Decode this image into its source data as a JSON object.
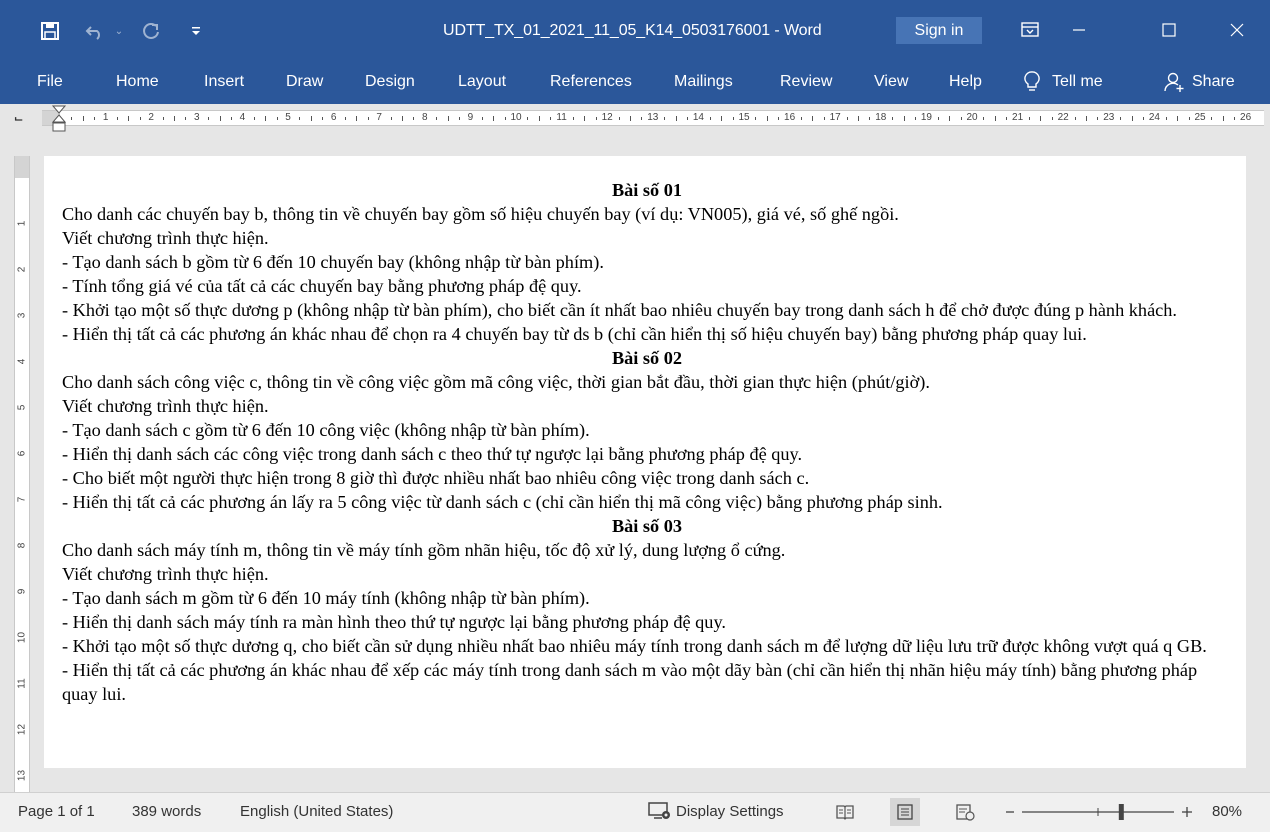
{
  "titlebar": {
    "doc_title": "UDTT_TX_01_2021_11_05_K14_0503176001  -  Word",
    "signin_label": "Sign in",
    "accent_color": "#2b579a"
  },
  "ribbon": {
    "tabs": [
      "File",
      "Home",
      "Insert",
      "Draw",
      "Design",
      "Layout",
      "References",
      "Mailings",
      "Review",
      "View",
      "Help"
    ],
    "tell_me": "Tell me",
    "share": "Share"
  },
  "ruler": {
    "labels": [
      "1",
      "2",
      "3",
      "4",
      "5",
      "6",
      "7",
      "8",
      "9",
      "10",
      "11",
      "12",
      "13",
      "14",
      "15",
      "16",
      "17",
      "18",
      "19",
      "20",
      "21",
      "22",
      "23",
      "24",
      "25",
      "26"
    ],
    "vertical_labels": [
      "1",
      "2",
      "3",
      "4",
      "5",
      "6",
      "7",
      "8",
      "9",
      "10",
      "11",
      "12",
      "13"
    ]
  },
  "document": {
    "sections": [
      {
        "heading": "Bài số 01",
        "lines": [
          "Cho danh các chuyến bay b, thông tin về chuyến bay gồm số hiệu chuyến bay (ví dụ: VN005), giá vé, số ghế ngồi.",
          "Viết chương trình thực hiện.",
          "- Tạo danh sách b gồm từ 6 đến 10 chuyến bay (không nhập từ bàn phím).",
          "- Tính tổng giá vé của tất cả các chuyến bay bằng phương pháp đệ quy.",
          "- Khởi tạo một số thực dương p (không nhập từ bàn phím), cho biết cần ít nhất bao nhiêu chuyến bay trong danh sách h để chở được đúng p hành khách.",
          "- Hiển thị tất cả các phương án khác nhau để chọn ra 4 chuyến bay từ ds b (chỉ cần hiển thị số hiệu chuyến bay) bằng phương pháp quay lui."
        ]
      },
      {
        "heading": "Bài số 02",
        "lines": [
          "Cho danh sách công việc c, thông tin về công việc gồm mã công việc, thời gian bắt đầu, thời gian thực hiện (phút/giờ).",
          "Viết chương trình thực hiện.",
          "- Tạo danh sách c gồm từ 6 đến 10 công việc (không nhập từ bàn phím).",
          "- Hiển thị danh sách các công việc trong danh sách c theo thứ tự ngược lại bằng phương pháp đệ quy.",
          "- Cho biết một người thực hiện trong 8 giờ thì được nhiều nhất bao nhiêu công việc trong danh sách c.",
          "- Hiển thị tất cả các phương án lấy ra 5 công việc từ danh sách c (chỉ cần hiển thị mã công việc) bằng phương pháp sinh."
        ]
      },
      {
        "heading": "Bài số 03",
        "lines": [
          "Cho danh sách máy tính m, thông tin về máy tính gồm nhãn hiệu, tốc độ xử lý, dung lượng ổ cứng.",
          "Viết chương trình thực hiện.",
          "- Tạo danh sách m gồm từ 6 đến 10 máy tính (không nhập từ bàn phím).",
          "- Hiển thị danh sách máy tính ra màn hình theo thứ tự ngược lại bằng phương pháp đệ quy.",
          "- Khởi tạo một số thực dương q, cho biết cần sử dụng nhiều nhất bao nhiêu máy tính trong danh sách m để lượng dữ liệu lưu trữ được không vượt quá q GB.",
          "- Hiển thị tất cả các phương án khác nhau để xếp các máy tính trong danh sách m vào một dãy bàn (chỉ cần hiển thị nhãn hiệu máy tính) bằng phương pháp quay lui."
        ]
      }
    ]
  },
  "statusbar": {
    "page": "Page 1 of 1",
    "words": "389 words",
    "language": "English (United States)",
    "display_settings": "Display Settings",
    "zoom_level": "80%",
    "zoom_fraction": 0.4
  }
}
